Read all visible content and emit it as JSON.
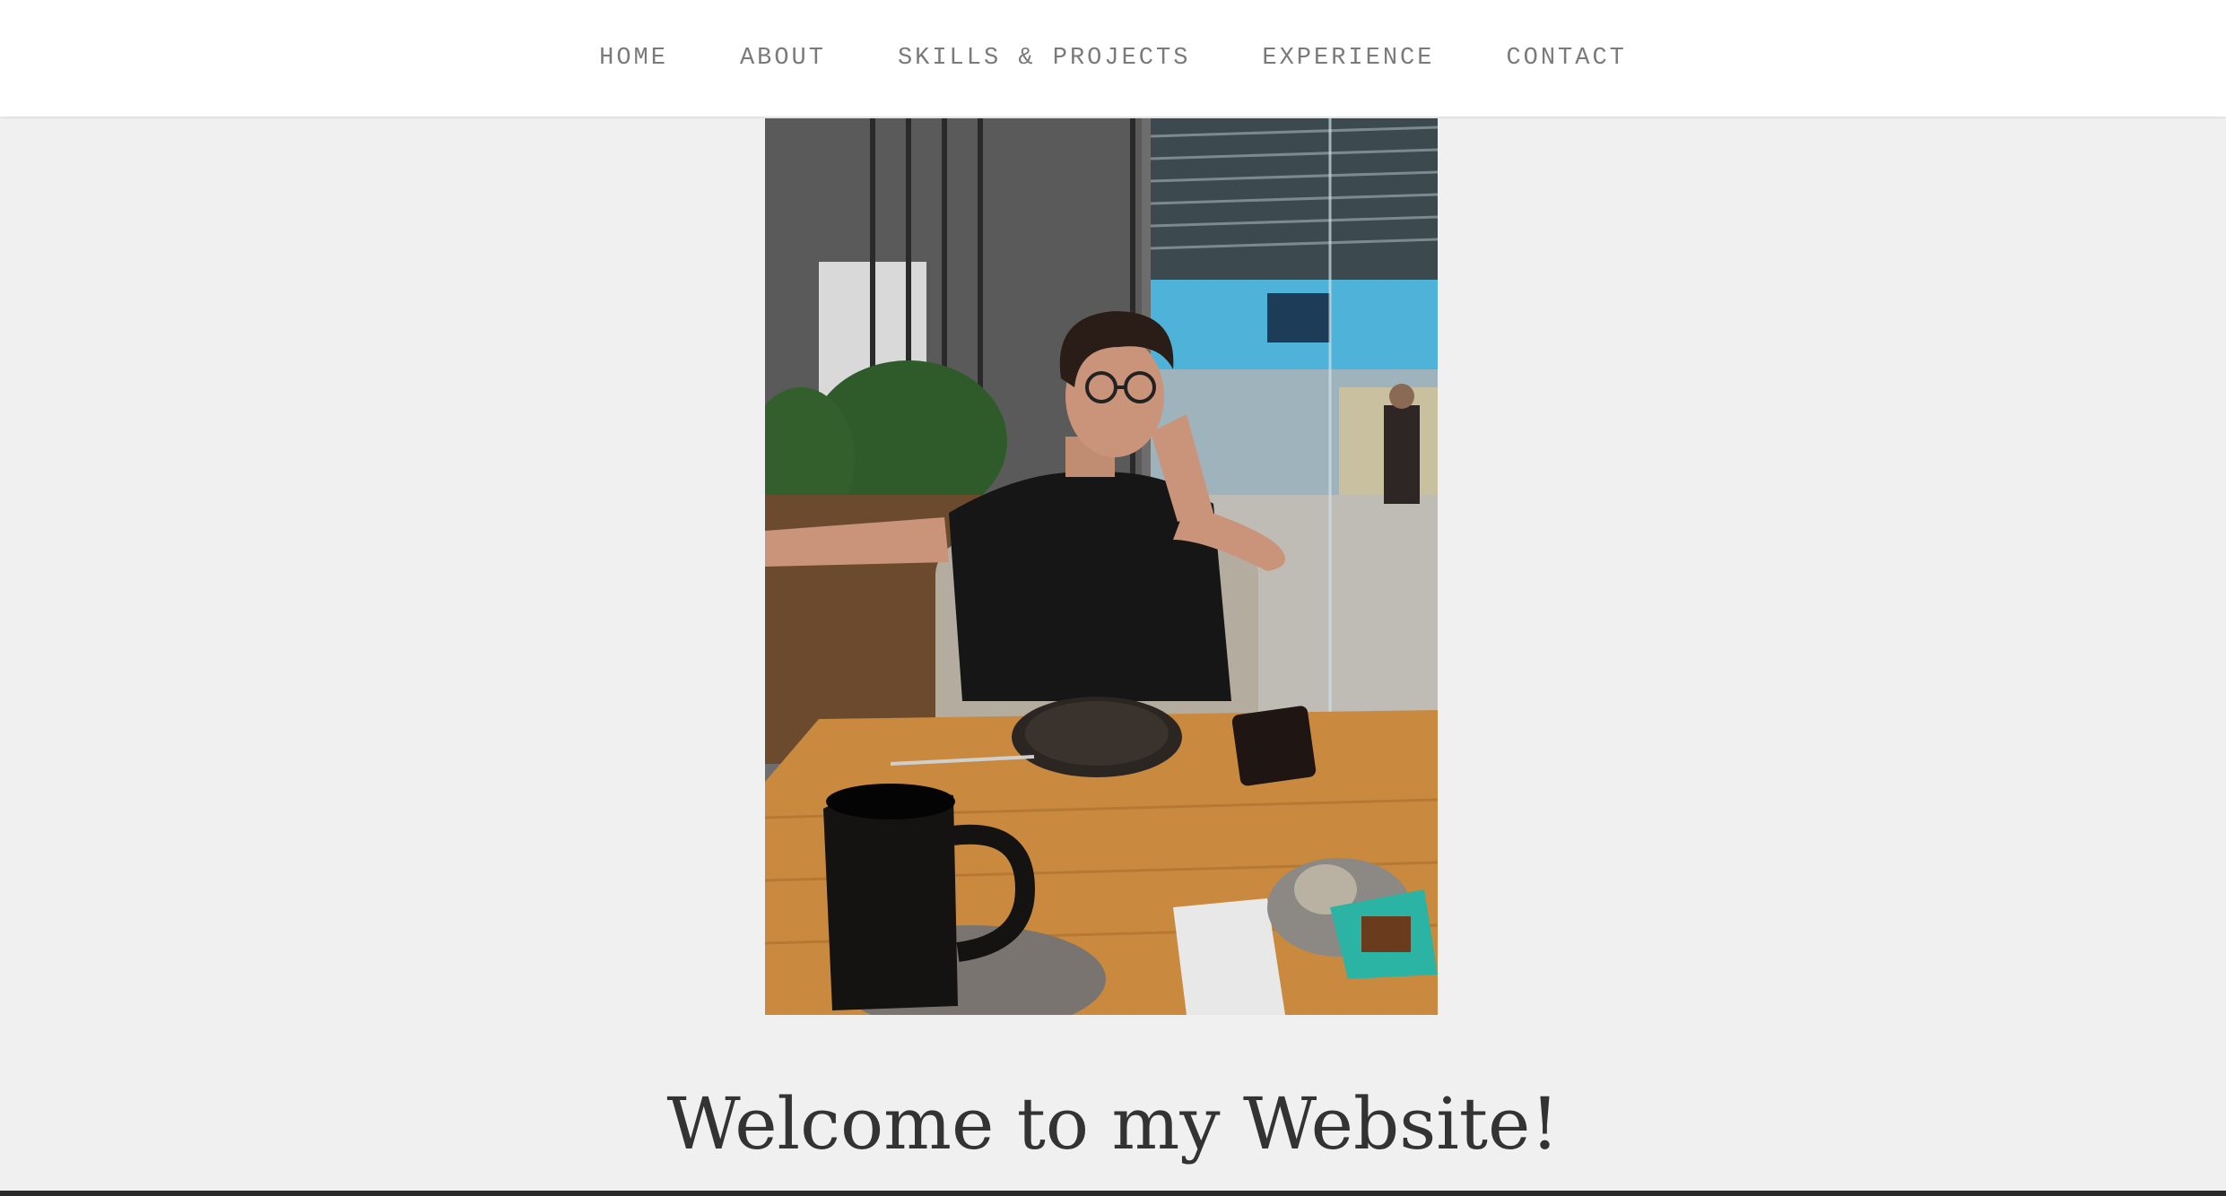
{
  "nav": {
    "items": [
      {
        "label": "HOME"
      },
      {
        "label": "ABOUT"
      },
      {
        "label": "SKILLS & PROJECTS"
      },
      {
        "label": "EXPERIENCE"
      },
      {
        "label": "CONTACT"
      }
    ]
  },
  "hero": {
    "welcome_text": "Welcome to my Website!"
  },
  "colors": {
    "page_background": "#f0f0f0",
    "nav_background": "#ffffff",
    "nav_text": "#7a7a7a",
    "heading_text": "#333333"
  }
}
